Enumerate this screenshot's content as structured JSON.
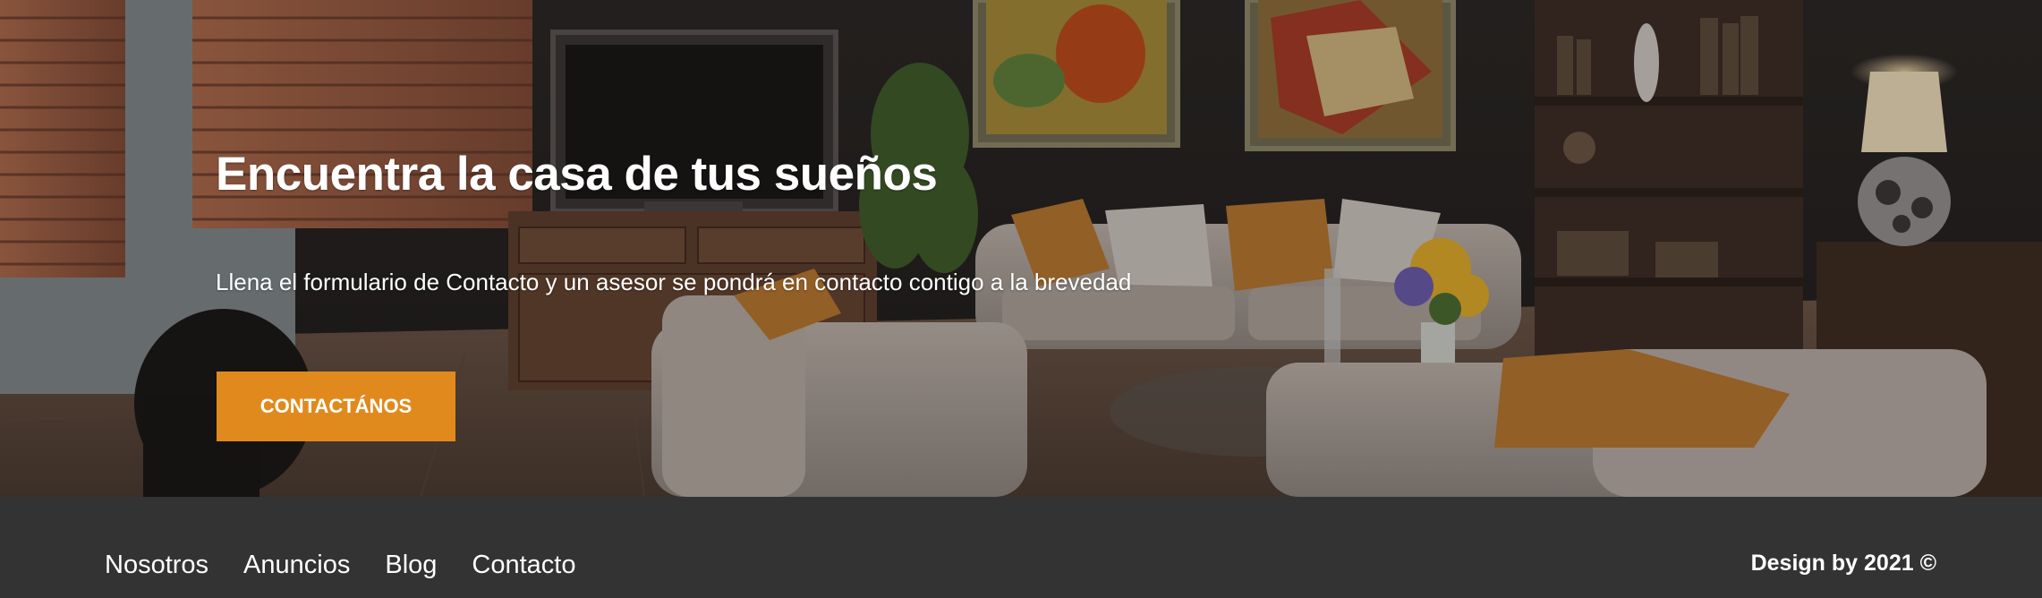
{
  "hero": {
    "title": "Encuentra la casa de tus sueños",
    "text": "Llena el formulario de Contacto y un asesor se pondrá en contacto contigo a la brevedad",
    "button_label": "CONTACTÁNOS",
    "background_image": "living-room-photo"
  },
  "footer": {
    "nav": [
      {
        "label": "Nosotros"
      },
      {
        "label": "Anuncios"
      },
      {
        "label": "Blog"
      },
      {
        "label": "Contacto"
      }
    ],
    "credit": "Design by 2021 ©"
  },
  "colors": {
    "accent": "#e08a1e",
    "footer_bg": "#333333",
    "text": "#ffffff"
  }
}
